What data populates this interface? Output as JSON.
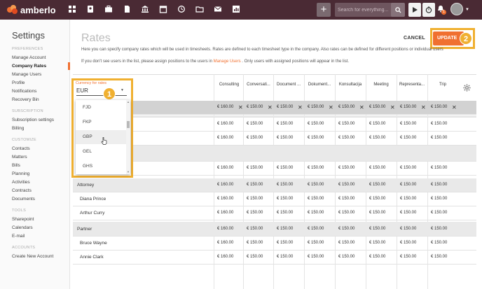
{
  "topbar": {
    "brand": "amberlo",
    "search_placeholder": "Search for everything...",
    "plus_label": "+",
    "notification_count": "1",
    "nav_icons": [
      "dashboard-icon",
      "contacts-icon",
      "matters-icon",
      "documents-icon",
      "bank-icon",
      "calendar-icon",
      "history-icon",
      "folder-icon",
      "mail-icon",
      "reports-icon"
    ]
  },
  "sidebar": {
    "title": "Settings",
    "sections": [
      {
        "label": "PREFERENCES",
        "items": [
          "Manage Account",
          "Company Rates",
          "Manage Users",
          "Profile",
          "Notifications",
          "Recovery Bin"
        ]
      },
      {
        "label": "SUBSCRIPTION",
        "items": [
          "Subscription settings",
          "Billing"
        ]
      },
      {
        "label": "CUSTOMIZE",
        "items": [
          "Contacts",
          "Matters",
          "Bills",
          "Planning",
          "Activities",
          "Contracts",
          "Documents"
        ]
      },
      {
        "label": "TOOLS",
        "items": [
          "Sharepoint",
          "Calendars",
          "E-mail"
        ]
      },
      {
        "label": "ACCOUNTS",
        "items": [
          "Create New Account"
        ]
      }
    ],
    "active_item": "Company Rates"
  },
  "page": {
    "title": "Rates",
    "cancel_label": "CANCEL",
    "update_label": "UPDATE",
    "info_line1": "Here you can specify company rates which will be used in timesheets. Rates are defined to each timesheet type in the company. Also rates can be defined for different positions or individual users",
    "info_line2_pre": "If you don't see users in the list, please assign positions to the users in",
    "info_line2_link": "Manage Users",
    "info_line2_post": ". Only users with assigned positions will appear in the list.",
    "callout_1": "1",
    "callout_2": "2"
  },
  "currency": {
    "label": "Currency for rates",
    "value": "EUR",
    "options": [
      "FJD",
      "FKP",
      "GBP",
      "GEL",
      "GHS"
    ],
    "hovered": "GBP"
  },
  "table": {
    "columns": [
      "Consulting",
      "Conversati...",
      "Document ...",
      "Dokument...",
      "Konsultacija",
      "Meeting",
      "Representa...",
      "Trip"
    ],
    "rows": [
      {
        "label": "",
        "values": [
          "€ 160.00",
          "€ 150.00",
          "€ 150.00",
          "€ 150.00",
          "€ 150.00",
          "€ 150.00",
          "€ 150.00",
          "€ 150.00"
        ],
        "style": "dark",
        "removable": true
      },
      {
        "label": "",
        "values": [],
        "style": "grey"
      },
      {
        "label": "",
        "values": [
          "€ 160.00",
          "€ 150.00",
          "€ 150.00",
          "€ 150.00",
          "€ 150.00",
          "€ 150.00",
          "€ 150.00",
          "€ 150.00"
        ],
        "style": "white"
      },
      {
        "label": "",
        "values": [
          "€ 160.00",
          "€ 150.00",
          "€ 150.00",
          "€ 150.00",
          "€ 150.00",
          "€ 150.00",
          "€ 150.00",
          "€ 150.00"
        ],
        "style": "white"
      },
      {
        "label": "",
        "values": [],
        "style": "grey"
      },
      {
        "label": "",
        "values": [
          "€ 160.00",
          "€ 150.00",
          "€ 150.00",
          "€ 150.00",
          "€ 150.00",
          "€ 150.00",
          "€ 150.00",
          "€ 150.00"
        ],
        "style": "white"
      },
      {
        "label": "Attorney",
        "values": [
          "€ 160.00",
          "€ 150.00",
          "€ 150.00",
          "€ 150.00",
          "€ 150.00",
          "€ 150.00",
          "€ 150.00",
          "€ 150.00"
        ],
        "style": "grey"
      },
      {
        "label": "Diana Prince",
        "values": [
          "€ 160.00",
          "€ 150.00",
          "€ 150.00",
          "€ 150.00",
          "€ 150.00",
          "€ 150.00",
          "€ 150.00",
          "€ 150.00"
        ],
        "style": "white",
        "sub": true
      },
      {
        "label": "Arthur Curry",
        "values": [
          "€ 160.00",
          "€ 150.00",
          "€ 150.00",
          "€ 150.00",
          "€ 150.00",
          "€ 150.00",
          "€ 150.00",
          "€ 150.00"
        ],
        "style": "white",
        "sub": true
      },
      {
        "label": "Partner",
        "values": [
          "€ 160.00",
          "€ 150.00",
          "€ 150.00",
          "€ 150.00",
          "€ 150.00",
          "€ 150.00",
          "€ 150.00",
          "€ 150.00"
        ],
        "style": "grey"
      },
      {
        "label": "Bruce Wayne",
        "values": [
          "€ 160.00",
          "€ 150.00",
          "€ 150.00",
          "€ 150.00",
          "€ 150.00",
          "€ 150.00",
          "€ 150.00",
          "€ 150.00"
        ],
        "style": "white",
        "sub": true
      },
      {
        "label": "Annie Clark",
        "values": [
          "€ 160.00",
          "€ 150.00",
          "€ 150.00",
          "€ 150.00",
          "€ 150.00",
          "€ 150.00",
          "€ 150.00",
          "€ 150.00"
        ],
        "style": "white",
        "sub": true
      }
    ],
    "remove_symbol": "✕"
  },
  "colors": {
    "topbar": "#4a2a34",
    "accent": "#f07030",
    "highlight": "#f0b030"
  }
}
